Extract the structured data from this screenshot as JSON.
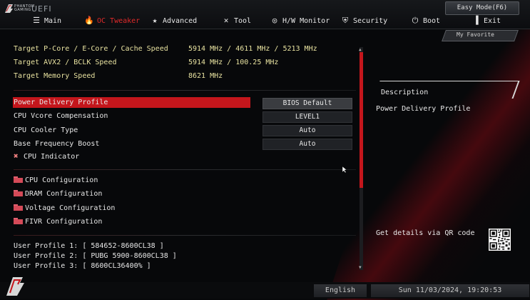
{
  "brand": {
    "top": "PHANTOM",
    "bottom": "GAMING",
    "uefi": "UEFI"
  },
  "nav": {
    "items": [
      {
        "label": "Main",
        "icon": "list-icon"
      },
      {
        "label": "OC Tweaker",
        "icon": "flame-icon"
      },
      {
        "label": "Advanced",
        "icon": "star-icon"
      },
      {
        "label": "Tool",
        "icon": "tools-icon"
      },
      {
        "label": "H/W Monitor",
        "icon": "monitor-icon"
      },
      {
        "label": "Security",
        "icon": "shield-icon"
      },
      {
        "label": "Boot",
        "icon": "power-icon"
      },
      {
        "label": "Exit",
        "icon": "exit-icon"
      }
    ],
    "easy_mode": "Easy Mode(F6)",
    "my_favorite": "My Favorite"
  },
  "info": [
    {
      "label": "Target P-Core / E-Core / Cache Speed",
      "value": "5914 MHz / 4611 MHz / 5213 MHz"
    },
    {
      "label": "Target AVX2 / BCLK Speed",
      "value": "5914 MHz / 100.25 MHz"
    },
    {
      "label": "Target Memory Speed",
      "value": "8621 MHz"
    }
  ],
  "settings": [
    {
      "label": "Power Delivery Profile",
      "value": "BIOS Default"
    },
    {
      "label": "CPU Vcore Compensation",
      "value": "LEVEL1"
    },
    {
      "label": "CPU Cooler Type",
      "value": "Auto"
    },
    {
      "label": "Base Frequency Boost",
      "value": "Auto"
    },
    {
      "label": "CPU Indicator"
    }
  ],
  "submenus": [
    {
      "label": "CPU Configuration"
    },
    {
      "label": "DRAM Configuration"
    },
    {
      "label": "Voltage Configuration"
    },
    {
      "label": "FIVR Configuration"
    }
  ],
  "profiles": [
    {
      "text": "User Profile 1: [ 584652-8600CL38 ]"
    },
    {
      "text": "User Profile 2: [ PUBG 5900-8600CL38 ]"
    },
    {
      "text": "User Profile 3: [ 8600CL36400% ]"
    }
  ],
  "description": {
    "title": "Description",
    "text": "Power Delivery Profile",
    "qr_text": "Get details via QR code"
  },
  "footer": {
    "language": "English",
    "datetime": "Sun 11/03/2024, 19:20:53"
  },
  "colors": {
    "accent": "#c4161c",
    "info_text": "#e8e2a0"
  }
}
